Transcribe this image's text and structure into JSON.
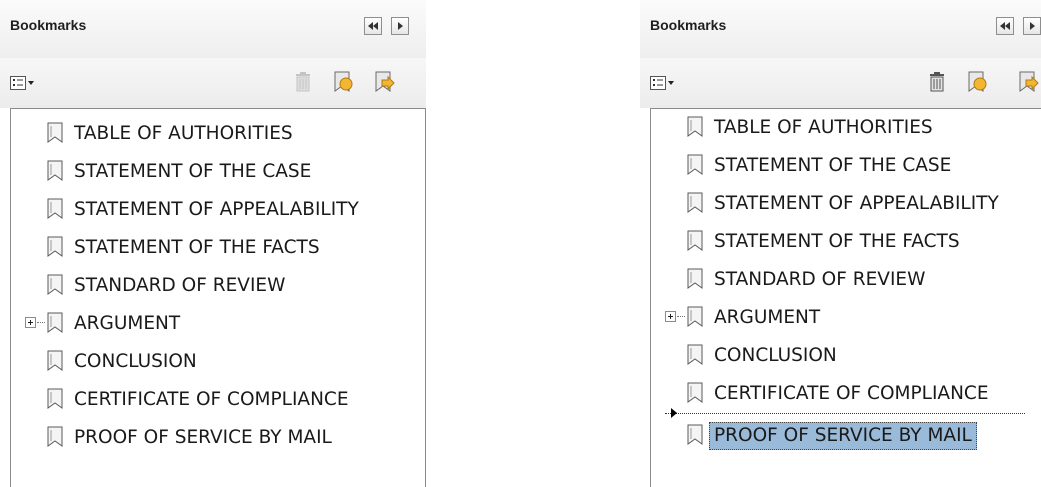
{
  "left_panel": {
    "title": "Bookmarks",
    "bookmarks": [
      {
        "label": "TABLE OF AUTHORITIES"
      },
      {
        "label": "STATEMENT OF THE CASE"
      },
      {
        "label": "STATEMENT OF APPEALABILITY"
      },
      {
        "label": "STATEMENT OF THE FACTS"
      },
      {
        "label": "STANDARD OF REVIEW"
      },
      {
        "label": "ARGUMENT",
        "expandable": true
      },
      {
        "label": "CONCLUSION"
      },
      {
        "label": "CERTIFICATE OF COMPLIANCE"
      },
      {
        "label": "PROOF OF SERVICE BY MAIL"
      }
    ]
  },
  "right_panel": {
    "title": "Bookmarks",
    "selected_item": "PROOF OF SERVICE BY MAIL",
    "bookmarks": [
      {
        "label": "TABLE OF AUTHORITIES"
      },
      {
        "label": "STATEMENT OF THE CASE"
      },
      {
        "label": "STATEMENT OF APPEALABILITY"
      },
      {
        "label": "STATEMENT OF THE FACTS"
      },
      {
        "label": "STANDARD OF REVIEW"
      },
      {
        "label": "ARGUMENT",
        "expandable": true
      },
      {
        "label": "CONCLUSION"
      },
      {
        "label": "CERTIFICATE OF COMPLIANCE"
      },
      {
        "label": "PROOF OF SERVICE BY MAIL",
        "selected": true
      }
    ]
  },
  "colors": {
    "selection": "#99bbd9",
    "border": "#8a8a8a",
    "header_bg": "#f2f2f2",
    "icon_gold": "#f2b632",
    "icon_blue": "#5a7ab8"
  },
  "icons": {
    "collapse_panel": "double-left-arrow",
    "options_menu": "options-list",
    "delete": "trash-can",
    "new_bookmark": "new-bookmark",
    "bookmark_from_structure": "bookmark-arrow",
    "bookmark": "bookmark-ribbon"
  }
}
